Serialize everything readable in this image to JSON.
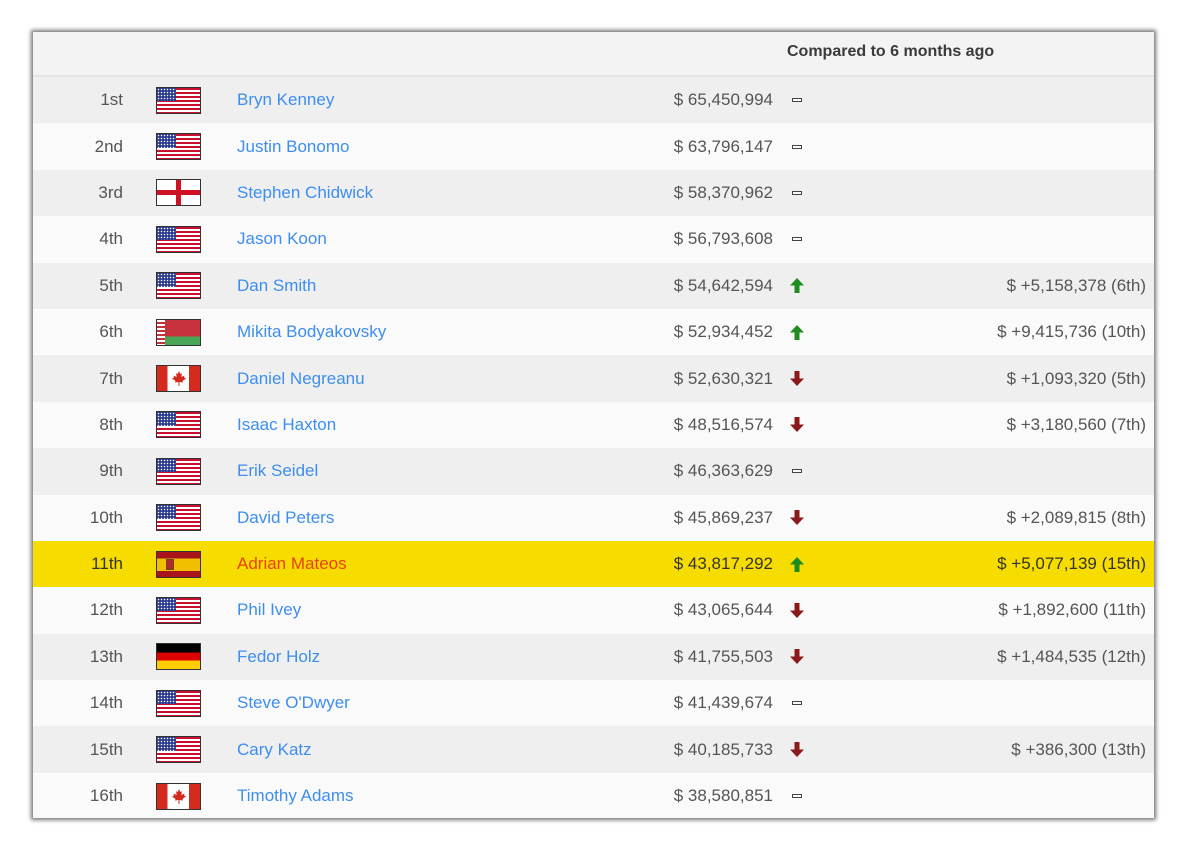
{
  "header": {
    "title": "Compared to 6 months ago"
  },
  "colors": {
    "accent_link": "#3d8ef0",
    "highlight_row": "#f7dc00",
    "highlight_name": "#e8420c",
    "up_arrow": "#1e8c1e",
    "down_arrow": "#8b1a1a"
  },
  "rows": [
    {
      "rank": "1st",
      "flag": "usa",
      "name": "Bryn Kenney",
      "earnings": "$ 65,450,994",
      "trend": "same",
      "change": ""
    },
    {
      "rank": "2nd",
      "flag": "usa",
      "name": "Justin Bonomo",
      "earnings": "$ 63,796,147",
      "trend": "same",
      "change": ""
    },
    {
      "rank": "3rd",
      "flag": "england",
      "name": "Stephen Chidwick",
      "earnings": "$ 58,370,962",
      "trend": "same",
      "change": ""
    },
    {
      "rank": "4th",
      "flag": "usa",
      "name": "Jason Koon",
      "earnings": "$ 56,793,608",
      "trend": "same",
      "change": ""
    },
    {
      "rank": "5th",
      "flag": "usa",
      "name": "Dan Smith",
      "earnings": "$ 54,642,594",
      "trend": "up",
      "change": "$ +5,158,378 (6th)"
    },
    {
      "rank": "6th",
      "flag": "belarus",
      "name": "Mikita Bodyakovsky",
      "earnings": "$ 52,934,452",
      "trend": "up",
      "change": "$ +9,415,736 (10th)"
    },
    {
      "rank": "7th",
      "flag": "canada",
      "name": "Daniel Negreanu",
      "earnings": "$ 52,630,321",
      "trend": "down",
      "change": "$ +1,093,320 (5th)"
    },
    {
      "rank": "8th",
      "flag": "usa",
      "name": "Isaac Haxton",
      "earnings": "$ 48,516,574",
      "trend": "down",
      "change": "$ +3,180,560 (7th)"
    },
    {
      "rank": "9th",
      "flag": "usa",
      "name": "Erik Seidel",
      "earnings": "$ 46,363,629",
      "trend": "same",
      "change": ""
    },
    {
      "rank": "10th",
      "flag": "usa",
      "name": "David Peters",
      "earnings": "$ 45,869,237",
      "trend": "down",
      "change": "$ +2,089,815 (8th)"
    },
    {
      "rank": "11th",
      "flag": "spain",
      "name": "Adrian Mateos",
      "earnings": "$ 43,817,292",
      "trend": "up",
      "change": "$ +5,077,139 (15th)",
      "highlighted": true
    },
    {
      "rank": "12th",
      "flag": "usa",
      "name": "Phil Ivey",
      "earnings": "$ 43,065,644",
      "trend": "down",
      "change": "$ +1,892,600 (11th)"
    },
    {
      "rank": "13th",
      "flag": "germany",
      "name": "Fedor Holz",
      "earnings": "$ 41,755,503",
      "trend": "down",
      "change": "$ +1,484,535 (12th)"
    },
    {
      "rank": "14th",
      "flag": "usa",
      "name": "Steve O'Dwyer",
      "earnings": "$ 41,439,674",
      "trend": "same",
      "change": ""
    },
    {
      "rank": "15th",
      "flag": "usa",
      "name": "Cary Katz",
      "earnings": "$ 40,185,733",
      "trend": "down",
      "change": "$ +386,300 (13th)"
    },
    {
      "rank": "16th",
      "flag": "canada",
      "name": "Timothy Adams",
      "earnings": "$ 38,580,851",
      "trend": "same",
      "change": ""
    }
  ]
}
